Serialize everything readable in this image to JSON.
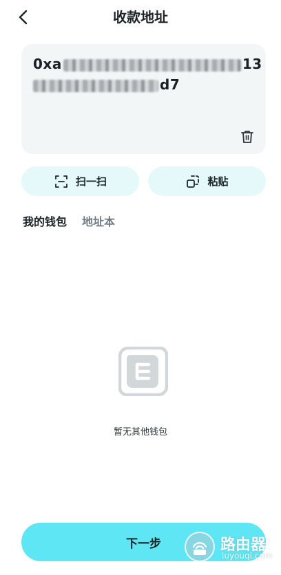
{
  "header": {
    "title": "收款地址"
  },
  "address": {
    "prefix": "0xa",
    "suffix_line1": "13",
    "suffix_line2": "d7"
  },
  "actions": {
    "scan_label": "扫一扫",
    "paste_label": "粘贴"
  },
  "tabs": [
    {
      "label": "我的钱包",
      "active": true
    },
    {
      "label": "地址本",
      "active": false
    }
  ],
  "empty": {
    "text": "暂无其他钱包"
  },
  "footer": {
    "next_label": "下一步"
  },
  "watermark": {
    "title": "路由器",
    "subtitle": "luyouqi.com"
  },
  "colors": {
    "primary": "#5ee6f4",
    "action_bg": "#e5f9fb",
    "card_bg": "#f3f6f7"
  }
}
